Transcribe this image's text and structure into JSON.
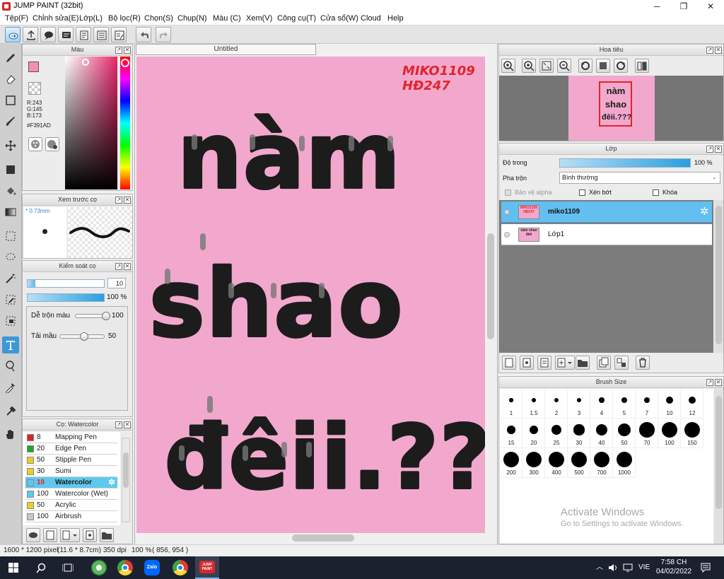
{
  "window": {
    "title": "JUMP PAINT (32bit)",
    "minimize": "─",
    "maximize": "❐",
    "close": "✕"
  },
  "menu": [
    "Tệp(F)",
    "Chỉnh sửa(E)",
    "Lớp(L)",
    "Bộ lọc(R)",
    "Chọn(S)",
    "Chụp(N)",
    "Màu (C)",
    "Xem(V)",
    "Công cụ(T)",
    "Cửa sổ(W)",
    "Cloud",
    "Help"
  ],
  "color_panel": {
    "title": "Màu",
    "r": "R:243",
    "g": "G:145",
    "b": "B:173",
    "hex": "#F391AD",
    "main_color": "#f391ad"
  },
  "preview_panel": {
    "title": "Xem trước cọ",
    "size": "* 0.73mm"
  },
  "brush_control": {
    "title": "Kiểm soát cọ",
    "size_value": "10",
    "opacity_value": "100 %",
    "blend_label": "Dễ trộn màu",
    "blend_value": "100",
    "ink_label": "Tải mầu",
    "ink_value": "50",
    "size_level": 0.1,
    "opacity_level": 1.0,
    "blend_level": 1.0,
    "ink_level": 0.5
  },
  "brush_list": {
    "title": "Cọ: Watercolor",
    "items": [
      {
        "size": "8",
        "name": "Mapping Pen",
        "color": "#e02020"
      },
      {
        "size": "20",
        "name": "Edge Pen",
        "color": "#1aa82a"
      },
      {
        "size": "50",
        "name": "Stipple Pen",
        "color": "#e8d020"
      },
      {
        "size": "30",
        "name": "Sumi",
        "color": "#e8d020"
      },
      {
        "size": "10",
        "name": "Watercolor",
        "color": "#5fc8f0",
        "selected": true
      },
      {
        "size": "100",
        "name": "Watercolor (Wet)",
        "color": "#5fc8f0"
      },
      {
        "size": "50",
        "name": "Acrylic",
        "color": "#e8d020"
      },
      {
        "size": "100",
        "name": "Airbrush",
        "color": "#c8c8c8"
      }
    ]
  },
  "document": {
    "tab": "Untitled",
    "signature_line1": "MIKO1109",
    "signature_line2": "HĐ247",
    "art_line1": "nàm",
    "art_line2": "shao",
    "art_line3": "đêii.???",
    "paper_color": "#f2a8cd"
  },
  "navigator": {
    "title": "Hoa tiêu",
    "thumb_line1": "nàm",
    "thumb_line2": "shao",
    "thumb_line3": "đêii.???"
  },
  "layer_panel": {
    "title": "Lớp",
    "opacity_label": "Độ trong",
    "opacity_value": "100 %",
    "opacity_level": 1.0,
    "blend_label": "Pha trộn",
    "blend_value": "Bình thường",
    "protect_alpha": "Bảo vệ alpha",
    "clipping": "Xén bớt",
    "lock": "Khóa",
    "layers": [
      {
        "name": "miko1109",
        "thumb_text": "MIKO1109 HĐ247",
        "selected": true
      },
      {
        "name": "Lớp1",
        "thumb_text": "nàm shao đêii",
        "selected": false
      }
    ]
  },
  "brush_size": {
    "title": "Brush Size",
    "sizes": [
      "1",
      "1.5",
      "2",
      "3",
      "4",
      "5",
      "7",
      "10",
      "12",
      "15",
      "20",
      "25",
      "30",
      "40",
      "50",
      "70",
      "100",
      "150",
      "200",
      "300",
      "400",
      "500",
      "700",
      "1000"
    ]
  },
  "watermark": {
    "line1": "Activate Windows",
    "line2": "Go to Settings to activate Windows."
  },
  "status": {
    "pixels": "1600 * 1200 pixel",
    "size": "(11.6 * 8.7cm)",
    "dpi": "350 dpi",
    "zoom": "100 %",
    "coord": "( 856, 954 )"
  },
  "taskbar": {
    "lang": "VIE",
    "time": "7:58 CH",
    "date": "04/02/2022",
    "zalo": "Zalo",
    "jump": "JUMP PAINT"
  }
}
